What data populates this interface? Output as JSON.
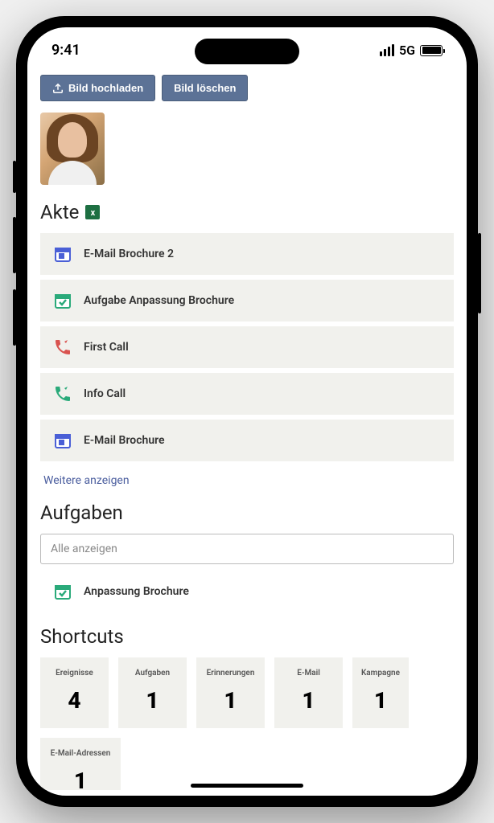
{
  "status": {
    "time": "9:41",
    "network": "5G"
  },
  "buttons": {
    "upload": "Bild hochladen",
    "delete": "Bild löschen"
  },
  "sections": {
    "akte_title": "Akte",
    "aufgaben_title": "Aufgaben",
    "shortcuts_title": "Shortcuts"
  },
  "akte": {
    "items": [
      {
        "icon": "calendar-blue",
        "label": "E-Mail Brochure 2"
      },
      {
        "icon": "checkbox-green",
        "label": "Aufgabe Anpassung Brochure"
      },
      {
        "icon": "phone-red",
        "label": "First Call"
      },
      {
        "icon": "phone-green",
        "label": "Info Call"
      },
      {
        "icon": "calendar-blue",
        "label": "E-Mail Brochure"
      }
    ],
    "more_label": "Weitere anzeigen"
  },
  "aufgaben": {
    "filter_placeholder": "Alle anzeigen",
    "items": [
      {
        "icon": "checkbox-green",
        "label": "Anpassung Brochure"
      }
    ]
  },
  "shortcuts": [
    {
      "label": "Ereignisse",
      "value": "4"
    },
    {
      "label": "Aufgaben",
      "value": "1"
    },
    {
      "label": "Erinnerungen",
      "value": "1"
    },
    {
      "label": "E-Mail",
      "value": "1"
    },
    {
      "label": "Kampagne",
      "value": "1"
    },
    {
      "label": "E-Mail-Adressen",
      "value": "1"
    }
  ]
}
